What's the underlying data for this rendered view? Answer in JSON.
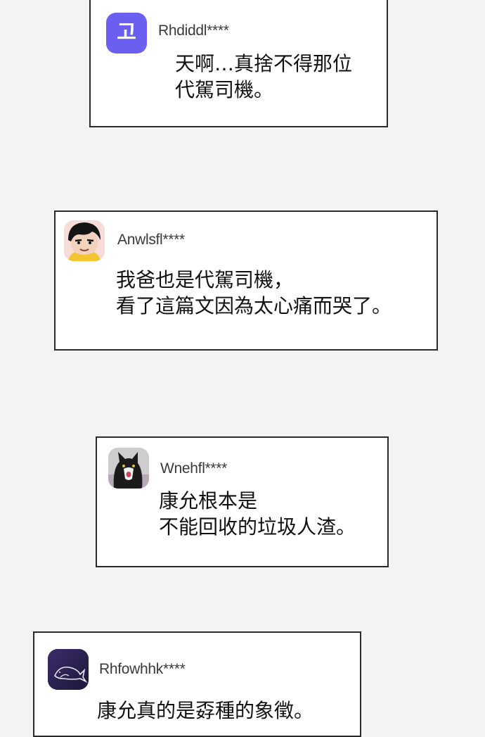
{
  "comments": [
    {
      "username": "Rhdiddl****",
      "avatar": {
        "type": "letter",
        "glyph": "고",
        "color": "#6b5ff2"
      },
      "lines": [
        "天啊…真捨不得那位",
        "代駕司機。"
      ]
    },
    {
      "username": "Anwlsfl****",
      "avatar": {
        "type": "illustration",
        "icon": "cartoon-face-avatar"
      },
      "lines": [
        "我爸也是代駕司機，",
        "看了這篇文因為太心痛而哭了。"
      ]
    },
    {
      "username": "Wnehfl****",
      "avatar": {
        "type": "photo",
        "icon": "cat-photo-avatar"
      },
      "lines": [
        "康允根本是",
        "不能回收的垃圾人渣。"
      ]
    },
    {
      "username": "Rhfowhhk****",
      "avatar": {
        "type": "illustration",
        "icon": "whale-avatar",
        "color": "#2c2450"
      },
      "lines": [
        "康允真的是孬種的象徵。"
      ]
    }
  ]
}
